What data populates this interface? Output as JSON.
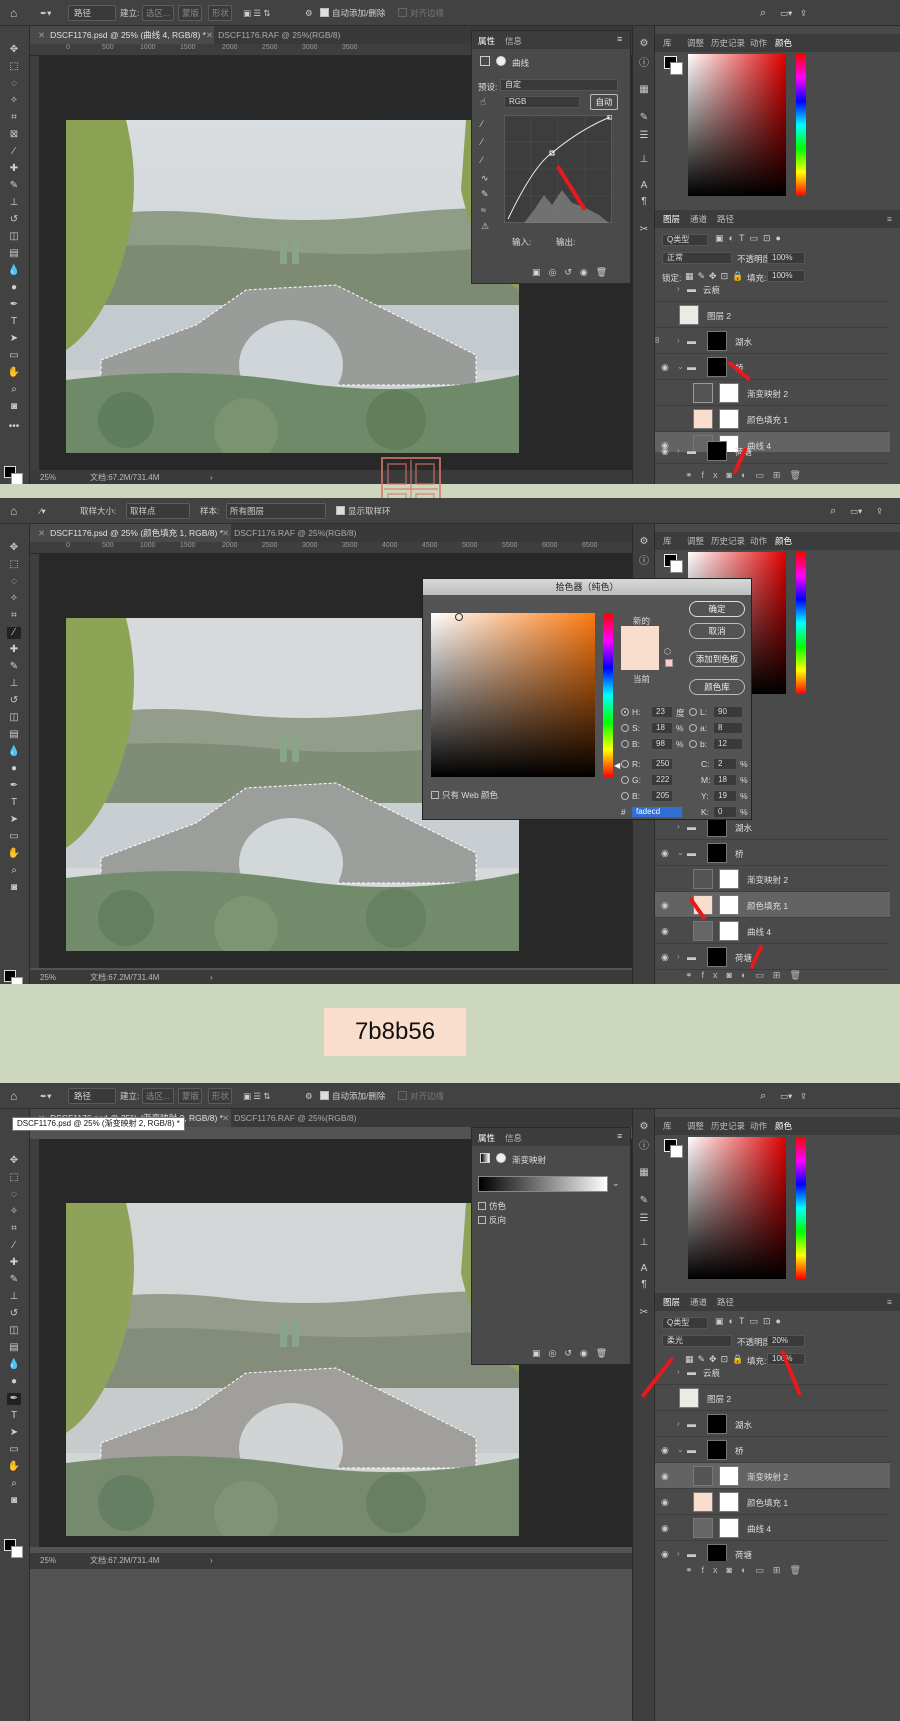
{
  "accent": "#e8181b",
  "shot1": {
    "tool_mode": "路径",
    "make_label": "建立:",
    "make_opts": [
      "选区...",
      "蒙版",
      "形状"
    ],
    "auto_add": "自动添加/删除",
    "align_edges": "对齐边缘",
    "tabs": [
      "DSCF1176.psd @ 25% (曲线 4, RGB/8) *",
      "DSCF1176.RAF @ 25%(RGB/8)"
    ],
    "ruler": [
      "0",
      "500",
      "1000",
      "1500",
      "2000",
      "2500",
      "3000",
      "3500"
    ],
    "zoom": "25%",
    "doc": "文档:67.2M/731.4M",
    "props": {
      "tabs": [
        "属性",
        "信息"
      ],
      "title": "曲线",
      "preset_label": "预设:",
      "preset": "自定",
      "channel": "RGB",
      "auto": "自动",
      "input": "输入:",
      "output": "输出:"
    },
    "panel_tabs": [
      "库",
      "调整",
      "历史记录",
      "动作",
      "颜色"
    ],
    "layer_tabs": [
      "图层",
      "通道",
      "路径"
    ],
    "kind": "Q类型",
    "blend": "正常",
    "opacity_label": "不透明度:",
    "opacity": "100%",
    "lock_label": "锁定:",
    "fill_label": "填充:",
    "fill": "100%",
    "layers": [
      "云痕",
      "图层 2",
      "湖水",
      "桥",
      "渐变映射 2",
      "颜色填充 1",
      "曲线 4",
      "荷塘"
    ]
  },
  "shot2": {
    "sample_size_label": "取样大小:",
    "sample_size": "取样点",
    "sample_label": "样本:",
    "sample": "所有图层",
    "show_ring": "显示取样环",
    "tabs": [
      "DSCF1176.psd @ 25% (颜色填充 1, RGB/8) *",
      "DSCF1176.RAF @ 25%(RGB/8)"
    ],
    "ruler": [
      "0",
      "500",
      "1000",
      "1500",
      "2000",
      "2500",
      "3000",
      "3500",
      "4000",
      "4500",
      "5000",
      "5500",
      "6000",
      "6500"
    ],
    "zoom": "25%",
    "doc": "文档:67.2M/731.4M",
    "picker": {
      "title": "拾色器（纯色）",
      "new": "新的",
      "current": "当前",
      "ok": "确定",
      "cancel": "取消",
      "add_swatch": "添加到色板",
      "library": "颜色库",
      "web_only": "只有 Web 颜色",
      "H": "23",
      "H_unit": "度",
      "S": "18",
      "S_unit": "%",
      "Bv": "98",
      "Bv_unit": "%",
      "R": "250",
      "G": "222",
      "B": "205",
      "L": "90",
      "a": "8",
      "b": "12",
      "C": "2",
      "M": "18",
      "Y": "19",
      "K": "0",
      "hex": "fadecd",
      "hash": "#",
      "new_color": "#fadecd"
    },
    "layers": [
      "湖水",
      "桥",
      "渐变映射 2",
      "颜色填充 1",
      "曲线 4",
      "荷塘"
    ]
  },
  "banner": {
    "text": "7b8b56",
    "bg": "#fadecd"
  },
  "shot3": {
    "tool_mode": "路径",
    "make_label": "建立:",
    "make_opts": [
      "选区...",
      "蒙版",
      "形状"
    ],
    "auto_add": "自动添加/删除",
    "align_edges": "对齐边缘",
    "tabs": [
      "DSCF1176.psd @ 25% (渐变映射 2, RGB/8) *",
      "DSCF1176.RAF @ 25%(RGB/8)"
    ],
    "tooltip": "DSCF1176.psd @ 25% (渐变映射 2, RGB/8) *",
    "zoom": "25%",
    "doc": "文档:67.2M/731.4M",
    "props": {
      "tabs": [
        "属性",
        "信息"
      ],
      "title": "渐变映射",
      "dither": "仿色",
      "reverse": "反向"
    },
    "blend": "柔光",
    "opacity_label": "不透明度:",
    "opacity": "20%",
    "fill_label": "填充:",
    "fill": "100%",
    "layers": [
      "云痕",
      "图层 2",
      "湖水",
      "桥",
      "渐变映射 2",
      "颜色填充 1",
      "曲线 4",
      "荷塘"
    ]
  }
}
